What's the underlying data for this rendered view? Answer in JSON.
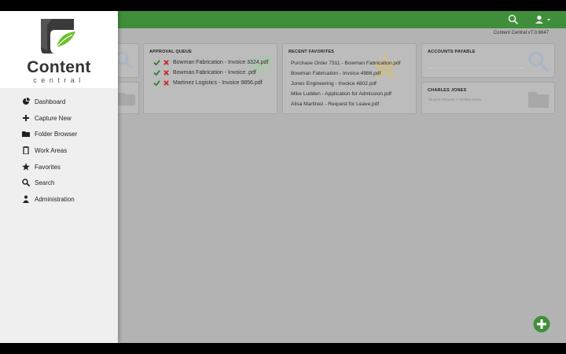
{
  "app": {
    "logo_word": "Content",
    "logo_sub": "central",
    "version": "Content Central v7.0.6647"
  },
  "header": {
    "search_icon": "search-icon",
    "user_icon": "user-icon"
  },
  "sidebar": {
    "items": [
      {
        "label": "Dashboard",
        "icon": "dashboard-icon"
      },
      {
        "label": "Capture New",
        "icon": "plus-icon"
      },
      {
        "label": "Folder Browser",
        "icon": "folder-icon"
      },
      {
        "label": "Work Areas",
        "icon": "clipboard-icon"
      },
      {
        "label": "Favorites",
        "icon": "star-icon"
      },
      {
        "label": "Search",
        "icon": "search-icon"
      },
      {
        "label": "Administration",
        "icon": "users-icon"
      }
    ]
  },
  "approval_queue": {
    "title": "APPROVAL QUEUE",
    "items": [
      "Bowman Fabrication - Invoice 3324.pdf",
      "Bowman Fabrication - Invoice .pdf",
      "Martinez Logistics - Invoice 9856.pdf"
    ]
  },
  "recent_favorites": {
    "title": "RECENT FAVORITES",
    "items": [
      "Purchase Order 7311 - Bowman Fabrication.pdf",
      "Bowman Fabrication - Invoice 4986.pdf",
      "Jones Engineering - Invoice 4802.pdf",
      "Mike Ludden - Application for Admission.pdf",
      "Alisa Martinez - Request for Leave.pdf"
    ]
  },
  "accounts_payable": {
    "title": "ACCOUNTS PAYABLE"
  },
  "charles_jones": {
    "title": "CHARLES JONES",
    "subtitle": "Student Records > Charles Jones"
  },
  "colors": {
    "brand_green": "#3f8f3a",
    "overlay_gray": "#b3b3b3",
    "check_green": "#2e7d32",
    "cross_red": "#c62828"
  }
}
